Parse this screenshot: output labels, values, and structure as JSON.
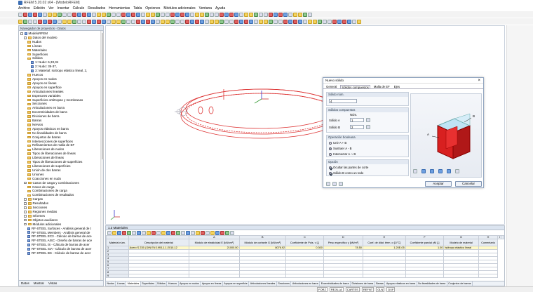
{
  "window": {
    "title": "RFEM 5.20.02 x64 - [ModeloRFEM]"
  },
  "menu": [
    "Archivo",
    "Edición",
    "Ver",
    "Insertar",
    "Cálculo",
    "Resultados",
    "Herramientas",
    "Tabla",
    "Opciones",
    "Módulos adicionales",
    "Ventana",
    "Ayuda"
  ],
  "navigator": {
    "title": "Navegador de proyectos - Datos",
    "tabs": [
      "Datos",
      "Mostrar",
      "Vistas"
    ],
    "tree": [
      {
        "label": "ModeloRFEM",
        "indent": 0,
        "icon": "model-icon"
      },
      {
        "label": "Datos del modelo",
        "indent": 1,
        "icon": "folder-icon"
      },
      {
        "label": "Nudos",
        "indent": 2,
        "icon": "folder-icon"
      },
      {
        "label": "Líneas",
        "indent": 2,
        "icon": "folder-icon"
      },
      {
        "label": "Materiales",
        "indent": 2,
        "icon": "folder-icon"
      },
      {
        "label": "Superficies",
        "indent": 2,
        "icon": "folder-icon"
      },
      {
        "label": "Sólidos",
        "indent": 2,
        "icon": "folder-icon"
      },
      {
        "label": "1: Nudo: 6,33,34",
        "indent": 3,
        "icon": "solid-icon"
      },
      {
        "label": "2: Nudo: 35-37,",
        "indent": 3,
        "icon": "solid-icon"
      },
      {
        "label": "3: Material: Isótropo elástico lineal, 2,",
        "indent": 3,
        "icon": "solid-icon"
      },
      {
        "label": "Huecos",
        "indent": 2,
        "icon": "folder-icon"
      },
      {
        "label": "Apoyos en nudos",
        "indent": 2,
        "icon": "folder-icon"
      },
      {
        "label": "Apoyos en líneas",
        "indent": 2,
        "icon": "folder-icon"
      },
      {
        "label": "Apoyos en superficie",
        "indent": 2,
        "icon": "folder-icon"
      },
      {
        "label": "Articulaciones lineales",
        "indent": 2,
        "icon": "folder-icon"
      },
      {
        "label": "Espesores variables",
        "indent": 2,
        "icon": "folder-icon"
      },
      {
        "label": "Superficies ortótropas y membranas",
        "indent": 2,
        "icon": "folder-icon"
      },
      {
        "label": "Secciones",
        "indent": 2,
        "icon": "folder-icon"
      },
      {
        "label": "Articulaciones en barra",
        "indent": 2,
        "icon": "folder-icon"
      },
      {
        "label": "Excentricidades de barra",
        "indent": 2,
        "icon": "folder-icon"
      },
      {
        "label": "Divisiones de barra",
        "indent": 2,
        "icon": "folder-icon"
      },
      {
        "label": "Barras",
        "indent": 2,
        "icon": "folder-icon"
      },
      {
        "label": "Nervios",
        "indent": 2,
        "icon": "folder-icon"
      },
      {
        "label": "Apoyos elásticos en barra",
        "indent": 2,
        "icon": "folder-icon"
      },
      {
        "label": "No linealidades de barra",
        "indent": 2,
        "icon": "folder-icon"
      },
      {
        "label": "Conjuntos de barras",
        "indent": 2,
        "icon": "folder-icon"
      },
      {
        "label": "Intersecciones de superficies",
        "indent": 2,
        "icon": "folder-icon"
      },
      {
        "label": "Refinamientos de malla de EF",
        "indent": 2,
        "icon": "folder-icon"
      },
      {
        "label": "Liberaciones de nudos",
        "indent": 2,
        "icon": "folder-icon"
      },
      {
        "label": "Tipos de liberaciones de líneas",
        "indent": 2,
        "icon": "folder-icon"
      },
      {
        "label": "Liberaciones de líneas",
        "indent": 2,
        "icon": "folder-icon"
      },
      {
        "label": "Tipos de liberaciones de superficies",
        "indent": 2,
        "icon": "folder-icon"
      },
      {
        "label": "Liberaciones de superficies",
        "indent": 2,
        "icon": "folder-icon"
      },
      {
        "label": "Unión de dos barras",
        "indent": 2,
        "icon": "folder-icon"
      },
      {
        "label": "Uniones",
        "indent": 2,
        "icon": "folder-icon"
      },
      {
        "label": "Coacciones en nudo",
        "indent": 2,
        "icon": "folder-icon"
      },
      {
        "label": "Casos de carga y combinaciones",
        "indent": 1,
        "icon": "folder-icon"
      },
      {
        "label": "Casos de carga",
        "indent": 2,
        "icon": "folder-icon"
      },
      {
        "label": "Combinaciones de carga",
        "indent": 2,
        "icon": "folder-icon"
      },
      {
        "label": "Combinaciones de resultados",
        "indent": 2,
        "icon": "folder-icon"
      },
      {
        "label": "Cargas",
        "indent": 1,
        "icon": "folder-icon"
      },
      {
        "label": "Resultados",
        "indent": 1,
        "icon": "folder-icon"
      },
      {
        "label": "Secciones",
        "indent": 1,
        "icon": "folder-icon"
      },
      {
        "label": "Regiones medias",
        "indent": 1,
        "icon": "folder-icon"
      },
      {
        "label": "Informes",
        "indent": 1,
        "icon": "folder-icon"
      },
      {
        "label": "Objetos auxiliares",
        "indent": 1,
        "icon": "folder-icon"
      },
      {
        "label": "Módulos adicionales",
        "indent": 1,
        "icon": "folder-icon"
      },
      {
        "label": "RF-STEEL Surfaces - Análisis general de t",
        "indent": 2,
        "icon": "module-icon"
      },
      {
        "label": "RF-STEEL Members - Análisis general de",
        "indent": 2,
        "icon": "module-icon"
      },
      {
        "label": "RF-STEEL EC3 - Cálculo de barras de ace",
        "indent": 2,
        "icon": "module-icon"
      },
      {
        "label": "RF-STEEL AISC - Diseño de barras de ace",
        "indent": 2,
        "icon": "module-icon"
      },
      {
        "label": "RF-STEEL IS - Cálculo de barras de acer",
        "indent": 2,
        "icon": "module-icon"
      },
      {
        "label": "RF-STEEL SIA - Cálculo de barras de acer",
        "indent": 2,
        "icon": "module-icon"
      },
      {
        "label": "RF-STEEL BS - Cálculo de barras de acer",
        "indent": 2,
        "icon": "module-icon"
      }
    ]
  },
  "dialog": {
    "title": "Nuevo sólido",
    "tabs": [
      "General",
      "Sólidos compuestos",
      "Malla de EF",
      "Ejes"
    ],
    "solid_no_label": "Sólido núm.",
    "solid_no": "4",
    "composite_label": "Sólidos compuestos",
    "num_label": "Núm.",
    "solid_a_label": "Sólido A",
    "solid_a": "1",
    "solid_b_label": "Sólido B",
    "solid_b": "2",
    "boolean_label": "Operación booleana",
    "op1": "Unir A + B",
    "op2": "Sustraer A - B",
    "op3": "Intersectar A ∩ B",
    "options_label": "Opción",
    "opt1": "Ocultar las partes de corte",
    "opt2": "Sólido B como un todo",
    "preview_a": "A",
    "preview_b": "B",
    "ok": "Aceptar",
    "cancel": "Cancelar"
  },
  "table": {
    "title": "1.3 Materiales",
    "col_letters": [
      "A",
      "B",
      "C",
      "D",
      "E",
      "F",
      "G",
      "H",
      "I"
    ],
    "headers": [
      "Material núm.",
      "Descripción del material",
      "Módulo de elasticidad E [kN/cm²]",
      "Módulo de cortante G [kN/cm²]",
      "Coeficiente de Pois. ν [-]",
      "Peso específico γ [kN/m³]",
      "Coef. de dilat. térm. α [1/°C]",
      "Coeficiente parcial γM [-]",
      "Modelo de material",
      "Comentario"
    ],
    "rows": [
      [
        "1",
        "Acero S 235 | DIN EN 1993-1-1:2010-12",
        "21000.00",
        "8076.92",
        "0.300",
        "78.50",
        "1.20E-05",
        "1.00",
        "Isótropo elástico lineal",
        ""
      ],
      [
        "2",
        "",
        "",
        "",
        "",
        "",
        "",
        "",
        "",
        ""
      ],
      [
        "3",
        "",
        "",
        "",
        "",
        "",
        "",
        "",
        "",
        ""
      ],
      [
        "4",
        "",
        "",
        "",
        "",
        "",
        "",
        "",
        "",
        ""
      ],
      [
        "5",
        "",
        "",
        "",
        "",
        "",
        "",
        "",
        "",
        ""
      ],
      [
        "6",
        "",
        "",
        "",
        "",
        "",
        "",
        "",
        "",
        ""
      ],
      [
        "7",
        "",
        "",
        "",
        "",
        "",
        "",
        "",
        "",
        ""
      ],
      [
        "8",
        "",
        "",
        "",
        "",
        "",
        "",
        "",
        "",
        ""
      ],
      [
        "9",
        "",
        "",
        "",
        "",
        "",
        "",
        "",
        "",
        ""
      ]
    ],
    "tabs": [
      "Nudos",
      "Líneas",
      "Materiales",
      "Superficies",
      "Sólidos",
      "Huecos",
      "Apoyos en nudos",
      "Apoyos en líneas",
      "Apoyos en superficie",
      "Articulaciones lineales",
      "Secciones",
      "Articulaciones en barra",
      "Excentricidades de barra",
      "Divisiones de barra",
      "Barras",
      "Apoyos elásticos en barra",
      "No linealidades de barra",
      "Conjuntos de barras"
    ],
    "active_tab": "Materiales"
  },
  "status": [
    "FORZ",
    "REJILLA",
    "CARTES",
    "REFNT",
    "GLN",
    "DXF"
  ]
}
